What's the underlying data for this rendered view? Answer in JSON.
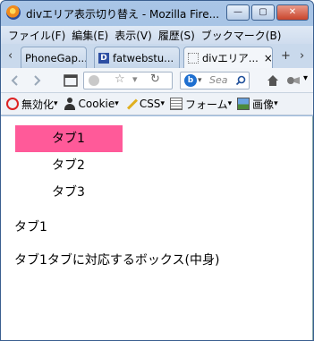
{
  "window": {
    "title": "divエリア表示切り替え - Mozilla Fire..."
  },
  "titlebar_buttons": {
    "minimize": "—",
    "maximize": "▢",
    "close": "✕"
  },
  "menu": [
    "ファイル(F)",
    "編集(E)",
    "表示(V)",
    "履歴(S)",
    "ブックマーク(B)"
  ],
  "tabs": [
    {
      "label": "PhoneGap..."
    },
    {
      "label": "fatwebstu..."
    },
    {
      "label": "divエリア...",
      "close": "×"
    }
  ],
  "tab_nav": {
    "left": "‹",
    "new": "+",
    "right": "›"
  },
  "search": {
    "placeholder": "Sea"
  },
  "toolbar": {
    "items": [
      "無効化",
      "Cookie",
      "CSS",
      "フォーム",
      "画像"
    ]
  },
  "page": {
    "tabs": [
      "タブ1",
      "タブ2",
      "タブ3"
    ],
    "selected_tab": "タブ1",
    "panel_title": "タブ1",
    "panel_body": "タブ1タブに対応するボックス(中身)"
  },
  "colors": {
    "selected_tab_bg": "#ff5a99"
  }
}
